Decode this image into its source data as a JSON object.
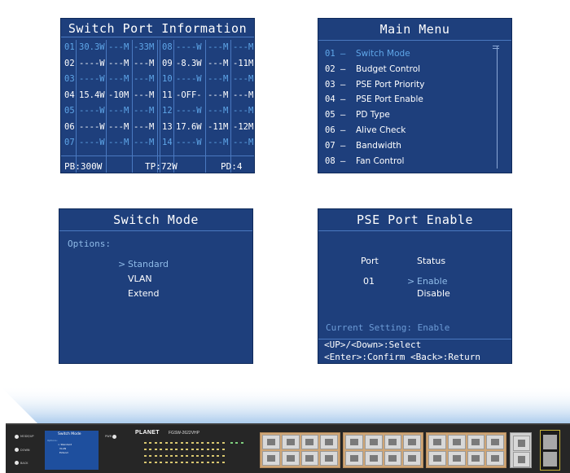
{
  "port_info": {
    "title": "Switch Port Information",
    "rows": [
      [
        "01",
        "30.3W",
        "---M",
        "-33M",
        "08",
        "----W",
        "---M",
        "---M"
      ],
      [
        "02",
        "----W",
        "---M",
        "---M",
        "09",
        "-8.3W",
        "---M",
        "-11M"
      ],
      [
        "03",
        "----W",
        "---M",
        "---M",
        "10",
        "----W",
        "---M",
        "---M"
      ],
      [
        "04",
        "15.4W",
        "-10M",
        "---M",
        "11",
        "-OFF-",
        "---M",
        "---M"
      ],
      [
        "05",
        "----W",
        "---M",
        "---M",
        "12",
        "----W",
        "---M",
        "---M"
      ],
      [
        "06",
        "----W",
        "---M",
        "---M",
        "13",
        "17.6W",
        "-11M",
        "-12M"
      ],
      [
        "07",
        "----W",
        "---M",
        "---M",
        "14",
        "----W",
        "---M",
        "---M"
      ]
    ],
    "footer": {
      "pb": "PB:300W",
      "tp": "TP:72W",
      "pd": "PD:4"
    }
  },
  "main_menu": {
    "title": "Main Menu",
    "items": [
      {
        "num": "01 –",
        "label": "Switch Mode"
      },
      {
        "num": "02 –",
        "label": "Budget Control"
      },
      {
        "num": "03 –",
        "label": "PSE Port Priority"
      },
      {
        "num": "04 –",
        "label": "PSE Port Enable"
      },
      {
        "num": "05 –",
        "label": "PD Type"
      },
      {
        "num": "06 –",
        "label": "Alive Check"
      },
      {
        "num": "07 –",
        "label": "Bandwidth"
      },
      {
        "num": "08 –",
        "label": "Fan Control"
      }
    ],
    "selected_index": 0
  },
  "switch_mode": {
    "title": "Switch Mode",
    "options_label": "Options:",
    "options": [
      {
        "arrow": ">",
        "label": "Standard"
      },
      {
        "arrow": "",
        "label": "VLAN"
      },
      {
        "arrow": "",
        "label": "Extend"
      }
    ]
  },
  "pse_port_enable": {
    "title": "PSE Port Enable",
    "port_header": "Port",
    "status_header": "Status",
    "port_value": "01",
    "arrow": ">",
    "status_options": [
      "Enable",
      "Disable"
    ],
    "current_setting": "Current Setting: Enable",
    "help_line1": "<UP>/<Down>:Select",
    "help_line2": "<Enter>:Confirm <Back>:Return"
  },
  "device": {
    "brand": "PLANET",
    "model": "FGSW-2622VHP",
    "lcd_title": "Switch Mode",
    "lcd_options_label": "Options:",
    "lcd_items": [
      "> Standard",
      "VLAN",
      "Extend"
    ],
    "btn_labels": [
      "MODE/UP",
      "DOWN",
      "BACK"
    ],
    "pwr_label": "PWR",
    "colors": {
      "panel_bg": "#1e3f7c",
      "highlight": "#5fa6e8",
      "chassis": "#262626",
      "port_frame": "#cfa676"
    }
  }
}
